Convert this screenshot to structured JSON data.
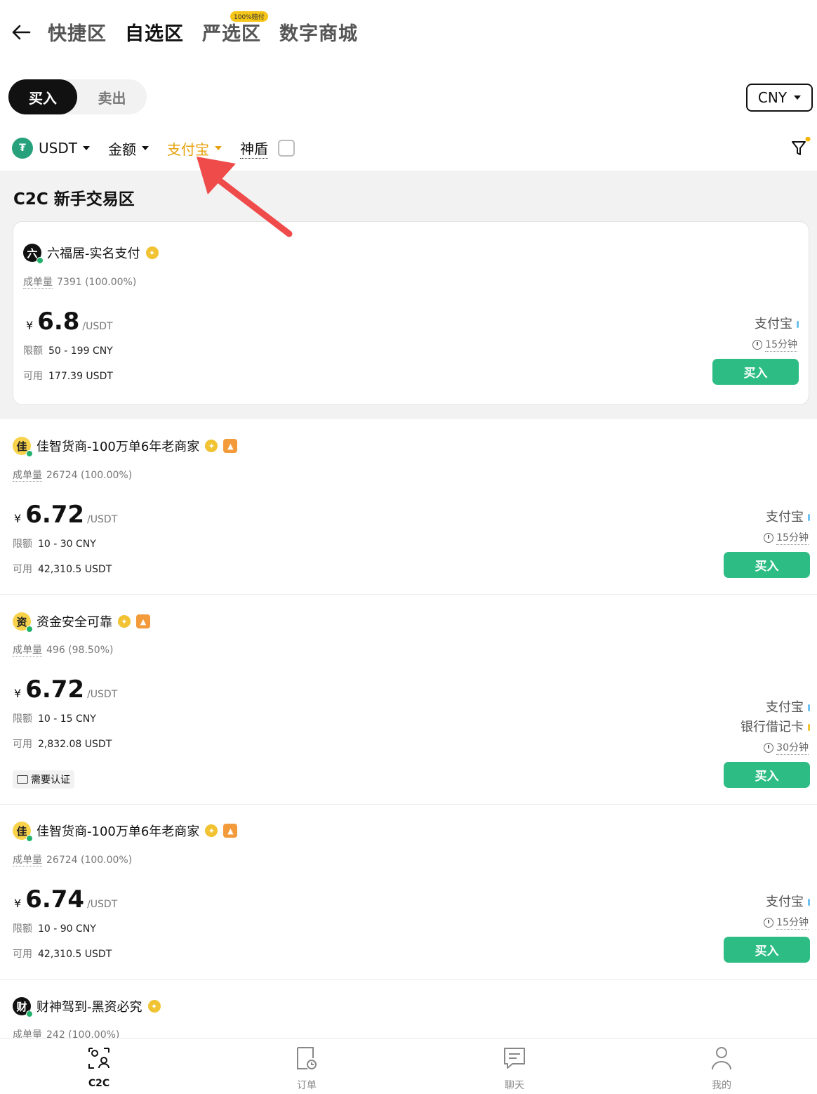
{
  "nav": {
    "tabs": [
      "快捷区",
      "自选区",
      "严选区",
      "数字商城"
    ],
    "active_tab": "自选区",
    "badge": "100%赔付"
  },
  "toggle": {
    "buy": "买入",
    "sell": "卖出"
  },
  "currency": "CNY",
  "filters": {
    "coin": "USDT",
    "amount": "金额",
    "payment": "支付宝",
    "shield": "神盾"
  },
  "zone_title": "C2C 新手交易区",
  "labels": {
    "volume": "成单量",
    "limit": "限额",
    "available": "可用",
    "buy": "买入",
    "unit": "/USDT",
    "yen": "¥",
    "need_verify": "需要认证"
  },
  "ads": [
    {
      "avatar": "六",
      "name": "六福居-实名支付",
      "volume": "7391 (100.00%)",
      "price": "6.8",
      "limit": "50 - 199 CNY",
      "available": "177.39 USDT",
      "payments": [
        "支付宝"
      ],
      "time": "15分钟"
    },
    {
      "avatar": "佳",
      "name": "佳智货商-100万单6年老商家",
      "volume": "26724 (100.00%)",
      "price": "6.72",
      "limit": "10 - 30 CNY",
      "available": "42,310.5 USDT",
      "payments": [
        "支付宝"
      ],
      "time": "15分钟"
    },
    {
      "avatar": "资",
      "name": "资金安全可靠",
      "volume": "496 (98.50%)",
      "price": "6.72",
      "limit": "10 - 15 CNY",
      "available": "2,832.08 USDT",
      "payments": [
        "支付宝",
        "银行借记卡"
      ],
      "time": "30分钟"
    },
    {
      "avatar": "佳",
      "name": "佳智货商-100万单6年老商家",
      "volume": "26724 (100.00%)",
      "price": "6.74",
      "limit": "10 - 90 CNY",
      "available": "42,310.5 USDT",
      "payments": [
        "支付宝"
      ],
      "time": "15分钟"
    },
    {
      "avatar": "财",
      "name": "财神驾到-黑资必究",
      "volume": "242 (100.00%)"
    }
  ],
  "bottom_nav": [
    "C2C",
    "订单",
    "聊天",
    "我的"
  ],
  "colors": {
    "accent": "#e7a10c",
    "buy_green": "#2dbd84",
    "arrow": "#f04b4b"
  }
}
